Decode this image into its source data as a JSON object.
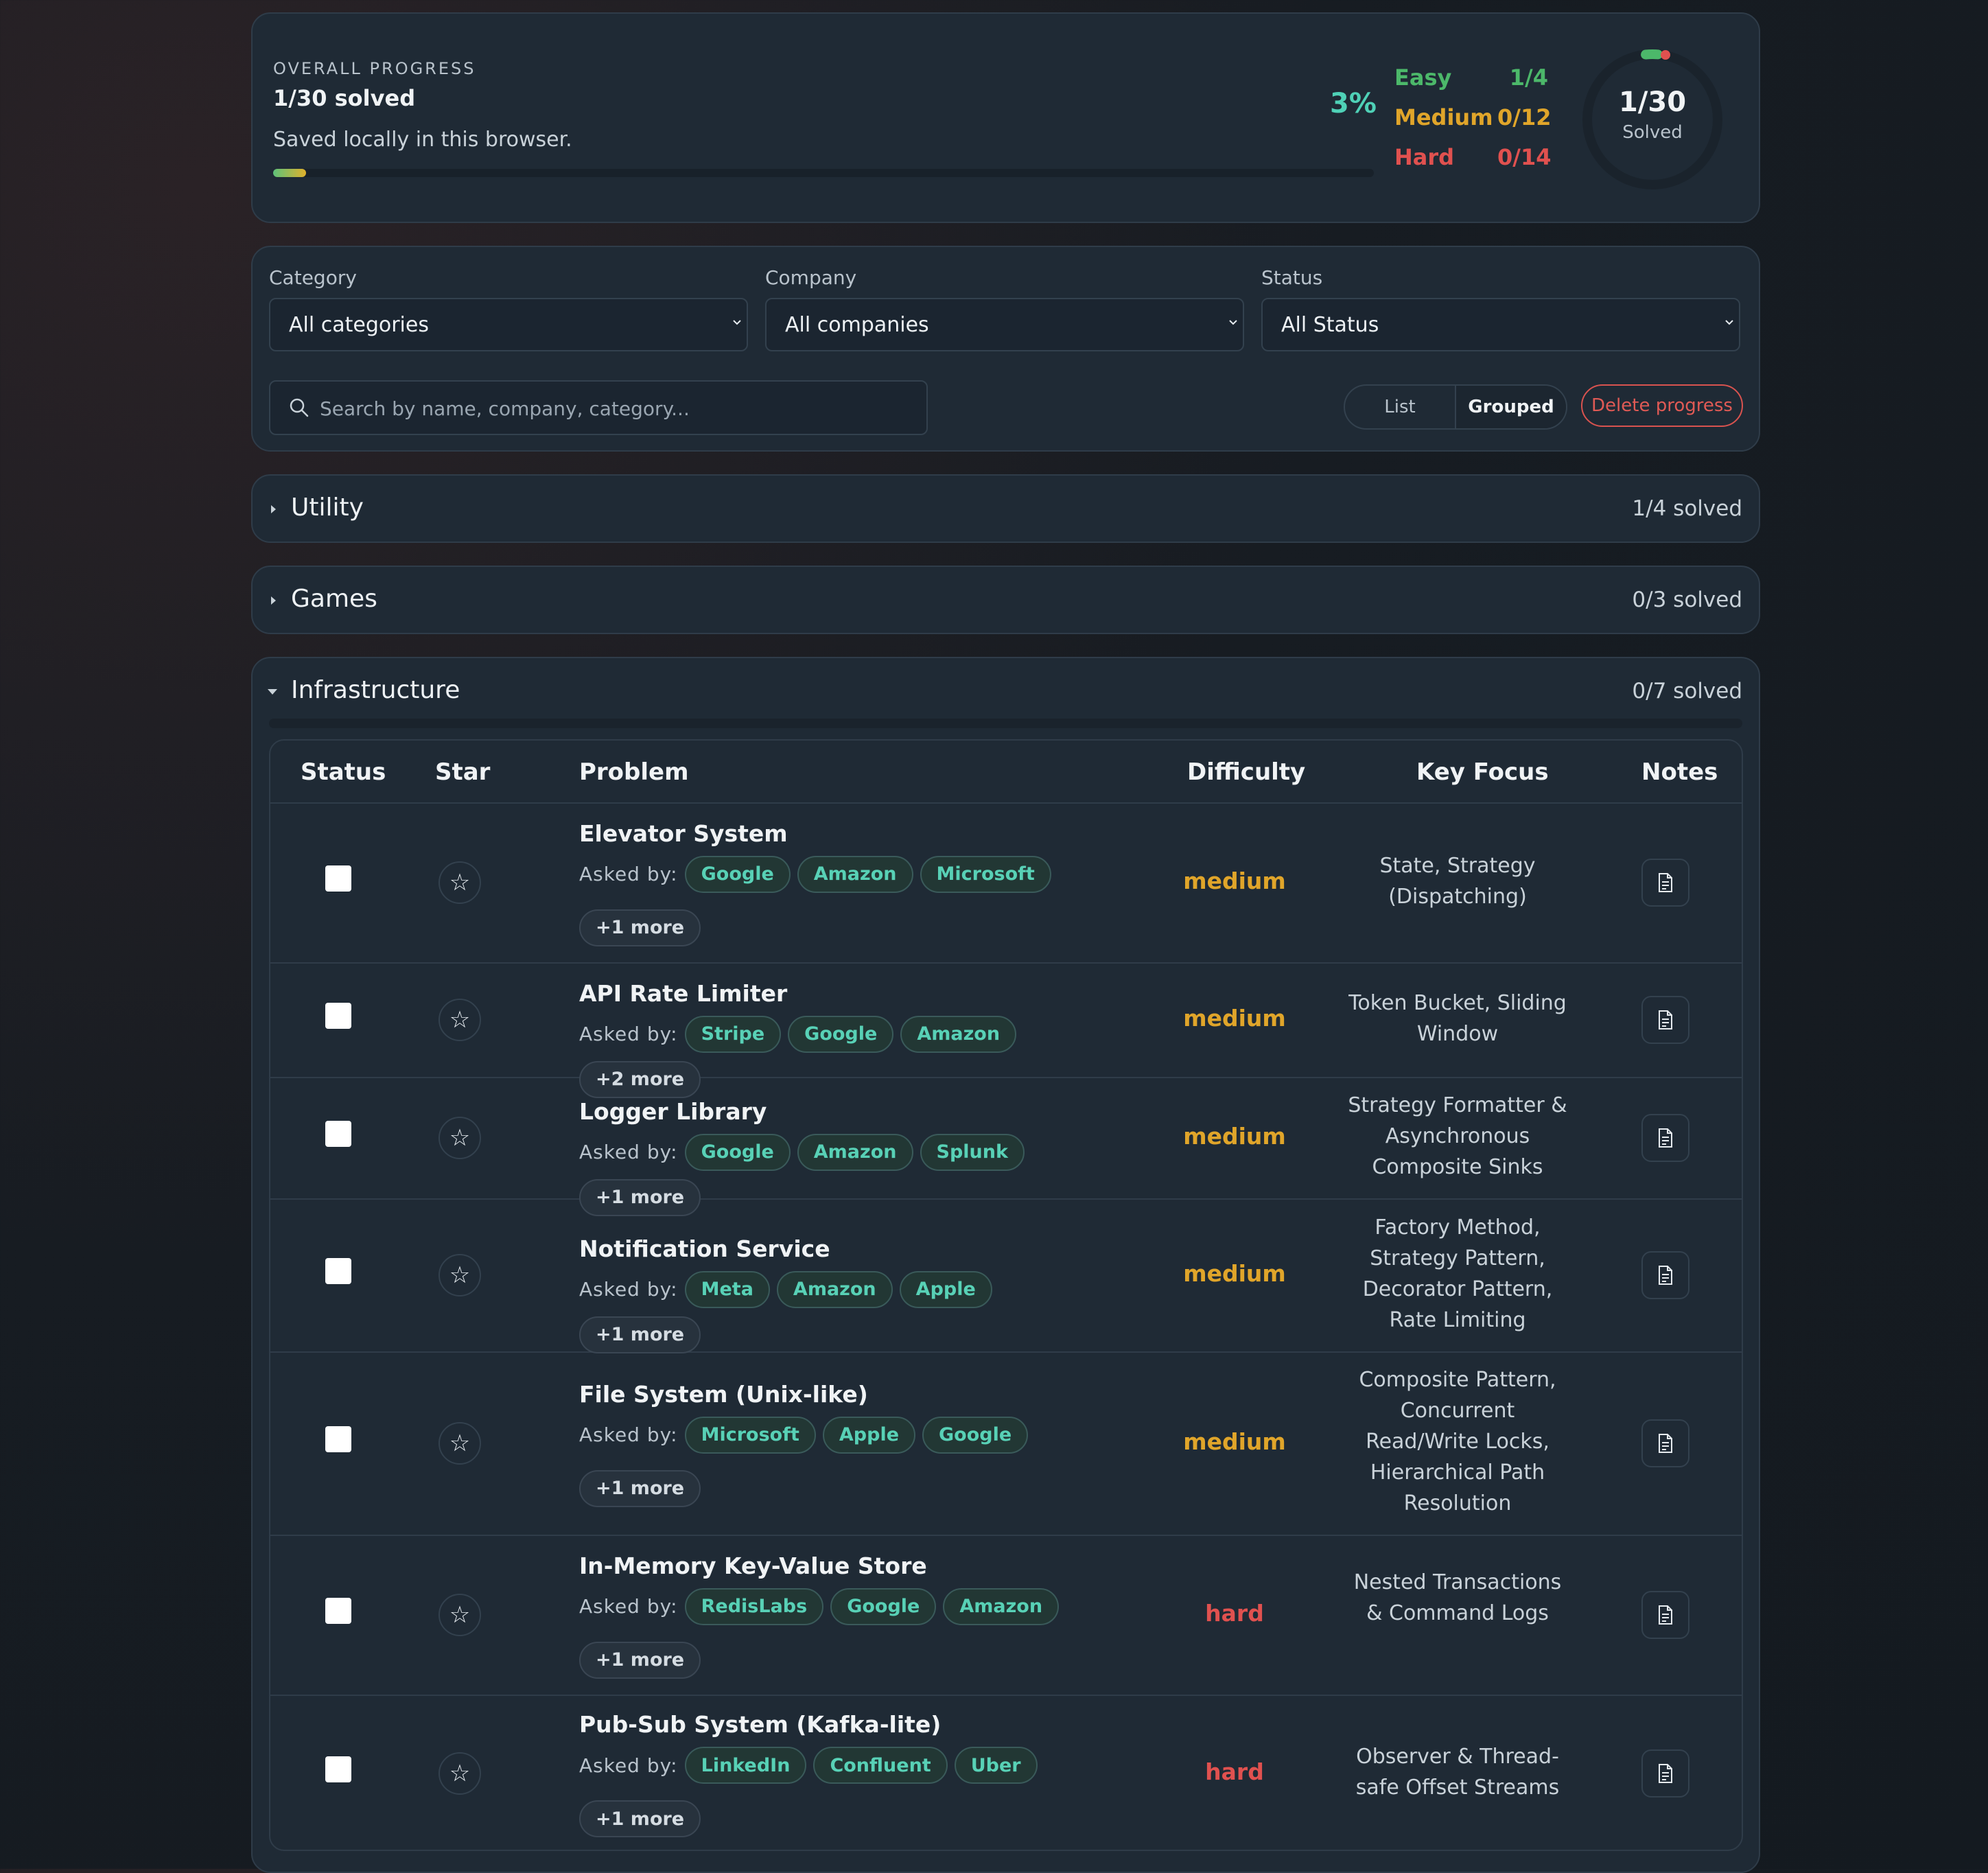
{
  "progress": {
    "label": "OVERALL PROGRESS",
    "solved_text": "1/30 solved",
    "saved_note": "Saved locally in this browser.",
    "percent_text": "3%",
    "percent_value": 3,
    "easy": {
      "label": "Easy",
      "value": "1/4",
      "color": "#4cb86a"
    },
    "medium": {
      "label": "Medium",
      "value": "0/12",
      "color": "#e0a52a"
    },
    "hard": {
      "label": "Hard",
      "value": "0/14",
      "color": "#e0514f"
    },
    "ring_number": "1/30",
    "ring_label": "Solved"
  },
  "filters": {
    "category_label": "Category",
    "category_value": "All categories",
    "company_label": "Company",
    "company_value": "All companies",
    "status_label": "Status",
    "status_value": "All Status",
    "search_placeholder": "Search by name, company, category...",
    "view_list": "List",
    "view_grouped": "Grouped",
    "delete_label": "Delete progress"
  },
  "groups": [
    {
      "title": "Utility",
      "count": "1/4 solved"
    },
    {
      "title": "Games",
      "count": "0/3 solved"
    },
    {
      "title": "Infrastructure",
      "count": "0/7 solved"
    }
  ],
  "table": {
    "headers": {
      "status": "Status",
      "star": "Star",
      "problem": "Problem",
      "difficulty": "Difficulty",
      "focus": "Key Focus",
      "notes": "Notes"
    },
    "asked_label": "Asked by:",
    "rows": [
      {
        "name": "Elevator System",
        "companies": [
          "Google",
          "Amazon",
          "Microsoft"
        ],
        "more": "+1 more",
        "difficulty": "medium",
        "focus": "State, Strategy (Dispatching)"
      },
      {
        "name": "API Rate Limiter",
        "companies": [
          "Stripe",
          "Google",
          "Amazon"
        ],
        "more": "+2 more",
        "difficulty": "medium",
        "focus": "Token Bucket, Sliding Window"
      },
      {
        "name": "Logger Library",
        "companies": [
          "Google",
          "Amazon",
          "Splunk"
        ],
        "more": "+1 more",
        "difficulty": "medium",
        "focus": "Strategy Formatter & Asynchronous Composite Sinks"
      },
      {
        "name": "Notification Service",
        "companies": [
          "Meta",
          "Amazon",
          "Apple"
        ],
        "more": "+1 more",
        "difficulty": "medium",
        "focus": "Factory Method, Strategy Pattern, Decorator Pattern, Rate Limiting"
      },
      {
        "name": "File System (Unix-like)",
        "companies": [
          "Microsoft",
          "Apple",
          "Google"
        ],
        "more": "+1 more",
        "difficulty": "medium",
        "focus": "Composite Pattern, Concurrent Read/Write Locks, Hierarchical Path Resolution"
      },
      {
        "name": "In-Memory Key-Value Store",
        "companies": [
          "RedisLabs",
          "Google",
          "Amazon"
        ],
        "more": "+1 more",
        "difficulty": "hard",
        "focus": "Nested Transactions & Command Logs"
      },
      {
        "name": "Pub-Sub System (Kafka-lite)",
        "companies": [
          "LinkedIn",
          "Confluent",
          "Uber"
        ],
        "more": "+1 more",
        "difficulty": "hard",
        "focus": "Observer & Thread-safe Offset Streams"
      }
    ]
  },
  "colors": {
    "accent": "#4fd1b7",
    "medium": "#e0a52a",
    "hard": "#e0514f",
    "easy": "#4cb86a"
  },
  "icons": [
    "chevron-down-icon",
    "search-icon",
    "caret-right-icon",
    "caret-down-icon",
    "star-icon",
    "note-icon"
  ]
}
